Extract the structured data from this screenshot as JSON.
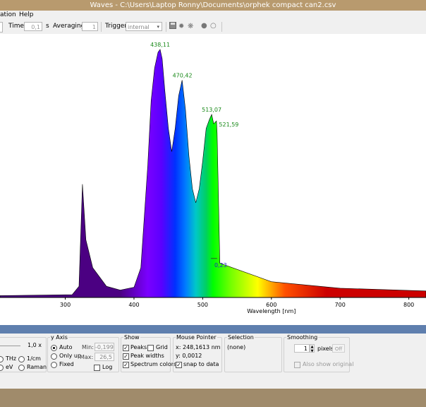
{
  "window": {
    "title": "Waves  -  C:\\Users\\Laptop Ronny\\Documents\\orphek compact can2.csv"
  },
  "menu": {
    "items": [
      "ation",
      "Help"
    ]
  },
  "toolbar": {
    "time_label": "Time:",
    "time_value": "0,1",
    "time_unit": "s",
    "averaging_label": "Averaging:",
    "averaging_value": "1",
    "trigger_label": "Trigger:",
    "trigger_value": "internal",
    "icons": [
      "save-icon",
      "sun-icon",
      "sun-dim-icon",
      "record-icon",
      "circle-icon"
    ]
  },
  "chart_data": {
    "type": "area",
    "xlabel": "Wavelength [nm]",
    "x_ticks": [
      300,
      400,
      500,
      600,
      700,
      800
    ],
    "xlim": [
      205,
      825
    ],
    "ylim": [
      -0.199,
      26.5
    ],
    "spectrum_colors": true,
    "peaks": [
      {
        "label": "438,11",
        "x": 438.11
      },
      {
        "label": "470,42",
        "x": 470.42
      },
      {
        "label": "513,07",
        "x": 513.07
      },
      {
        "label": "521,59",
        "x": 521.59
      }
    ],
    "width_label": "0,23",
    "series": [
      {
        "x": [
          205,
          310,
          320,
          325,
          330,
          340,
          360,
          380,
          400,
          410,
          420,
          425,
          430,
          435,
          438,
          441,
          445,
          450,
          455,
          460,
          465,
          470,
          475,
          480,
          485,
          490,
          495,
          500,
          505,
          510,
          513,
          516,
          520,
          521,
          525,
          600,
          700,
          825
        ],
        "y": [
          0.0,
          0.1,
          1.0,
          12.0,
          6.0,
          3.0,
          1.0,
          0.6,
          0.9,
          3.0,
          14.0,
          21.0,
          24.5,
          26.2,
          26.5,
          25.5,
          22.0,
          18.0,
          15.5,
          18.0,
          21.5,
          23.2,
          20.0,
          15.0,
          11.5,
          10.0,
          11.5,
          14.5,
          18.0,
          19.0,
          19.5,
          18.5,
          18.8,
          17.5,
          3.5,
          1.5,
          0.8,
          0.5
        ]
      }
    ]
  },
  "yaxis": {
    "title": "y Axis",
    "auto_label": "Auto",
    "only_up_label": "Only up",
    "fixed_label": "Fixed",
    "min_label": "Min:",
    "min_value": "-0,199",
    "max_label": "Max:",
    "max_value": "26,5",
    "log_label": "Log"
  },
  "xunits": {
    "zoom": "1,0 x",
    "thz": "THz",
    "cm": "1/cm",
    "ev": "eV",
    "raman": "Raman"
  },
  "show": {
    "title": "Show",
    "peaks": "Peaks",
    "grid": "Grid",
    "peak_widths": "Peak widths",
    "spectrum_colors": "Spectrum colors"
  },
  "mouse": {
    "title": "Mouse Pointer",
    "x": "x: 248,1613 nm",
    "y": "y: 0,0012",
    "snap": "snap to data"
  },
  "selection": {
    "title": "Selection",
    "value": "(none)"
  },
  "smoothing": {
    "title": "Smoothing",
    "value": "1",
    "unit": "pixels",
    "off": "Off",
    "also_show": "Also show original"
  }
}
